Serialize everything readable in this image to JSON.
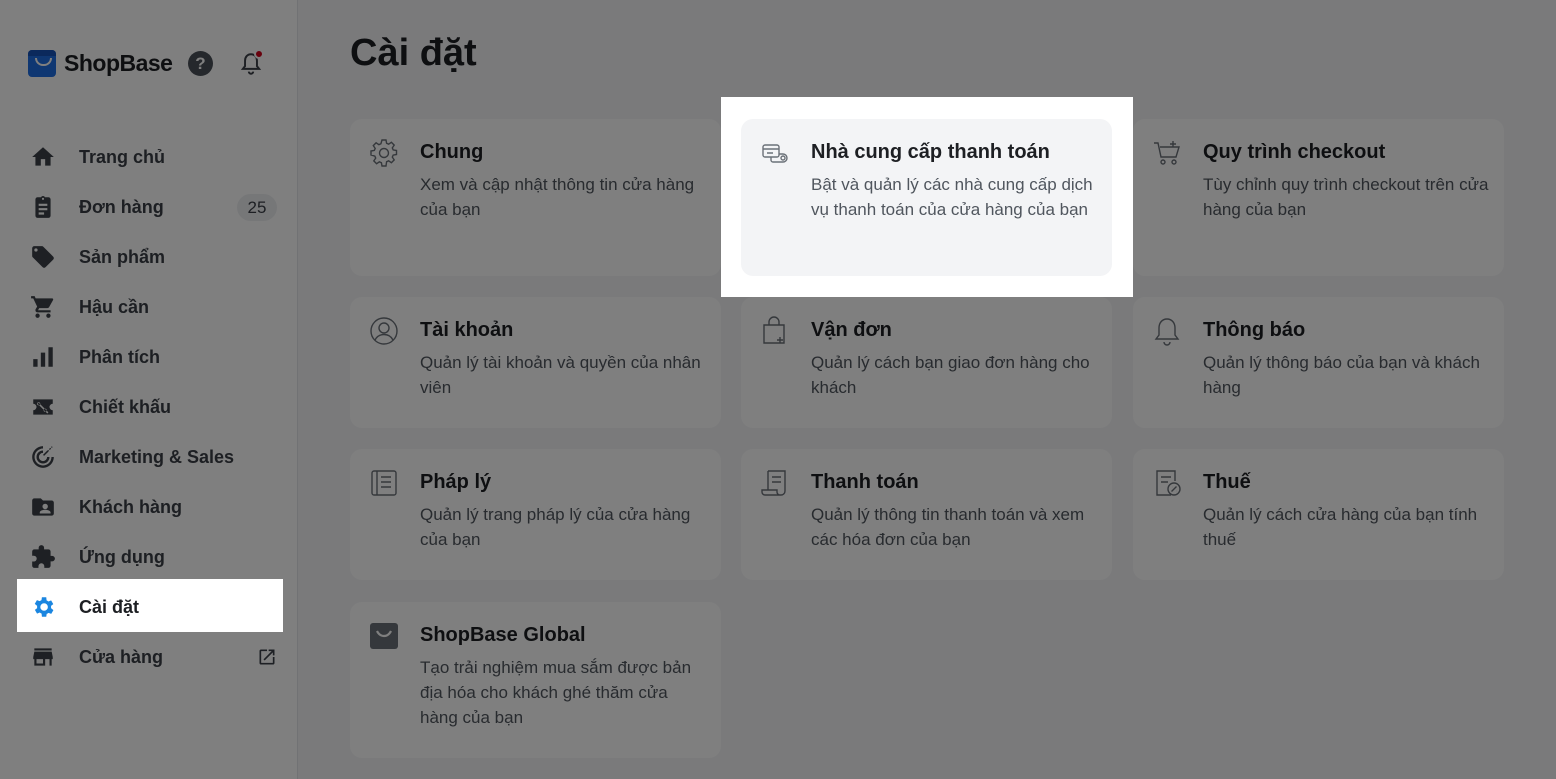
{
  "brand": {
    "name": "ShopBase",
    "help_icon": "question-circle-icon",
    "bell_icon": "bell-icon"
  },
  "sidebar": {
    "items": [
      {
        "label": "Trang chủ",
        "icon": "home-icon"
      },
      {
        "label": "Đơn hàng",
        "icon": "clipboard-icon",
        "badge": "25"
      },
      {
        "label": "Sản phẩm",
        "icon": "tag-icon"
      },
      {
        "label": "Hậu cần",
        "icon": "cart-icon"
      },
      {
        "label": "Phân tích",
        "icon": "bar-chart-icon"
      },
      {
        "label": "Chiết khấu",
        "icon": "discount-icon"
      },
      {
        "label": "Marketing & Sales",
        "icon": "target-icon"
      },
      {
        "label": "Khách hàng",
        "icon": "customer-icon"
      },
      {
        "label": "Ứng dụng",
        "icon": "puzzle-icon"
      },
      {
        "label": "Cài đặt",
        "icon": "gear-icon",
        "active": true
      },
      {
        "label": "Cửa hàng",
        "icon": "store-icon",
        "external_icon": "external-link-icon"
      }
    ]
  },
  "main": {
    "title": "Cài đặt",
    "cards": [
      {
        "title": "Chung",
        "desc": "Xem và cập nhật thông tin cửa hàng của bạn",
        "icon": "gear-icon"
      },
      {
        "title": "Nhà cung cấp thanh toán",
        "desc": "Bật và quản lý các nhà cung cấp dịch vụ thanh toán của cửa hàng của bạn",
        "icon": "payment-provider-icon"
      },
      {
        "title": "Quy trình checkout",
        "desc": "Tùy chỉnh quy trình checkout trên cửa hàng của bạn",
        "icon": "checkout-cart-icon"
      },
      {
        "title": "Tài khoản",
        "desc": "Quản lý tài khoản và quyền của nhân viên",
        "icon": "account-icon"
      },
      {
        "title": "Vận đơn",
        "desc": "Quản lý cách bạn giao đơn hàng cho khách",
        "icon": "shipping-bag-icon"
      },
      {
        "title": "Thông báo",
        "desc": "Quản lý thông báo của bạn và khách hàng",
        "icon": "bell-icon"
      },
      {
        "title": "Pháp lý",
        "desc": "Quản lý trang pháp lý của cửa hàng của bạn",
        "icon": "legal-document-icon"
      },
      {
        "title": "Thanh toán",
        "desc": "Quản lý thông tin thanh toán và xem các hóa đơn của bạn",
        "icon": "invoice-icon"
      },
      {
        "title": "Thuế",
        "desc": "Quản lý cách cửa hàng của bạn tính thuế",
        "icon": "tax-icon"
      },
      {
        "title": "ShopBase Global",
        "desc": "Tạo trải nghiệm mua sắm được bản địa hóa cho khách ghé thăm cửa hàng của bạn",
        "icon": "shopbase-global-icon"
      }
    ]
  },
  "colors": {
    "accent": "#1b86e0",
    "badge_dot": "#d0021b",
    "overlay": "rgba(0,0,0,0.5)"
  }
}
